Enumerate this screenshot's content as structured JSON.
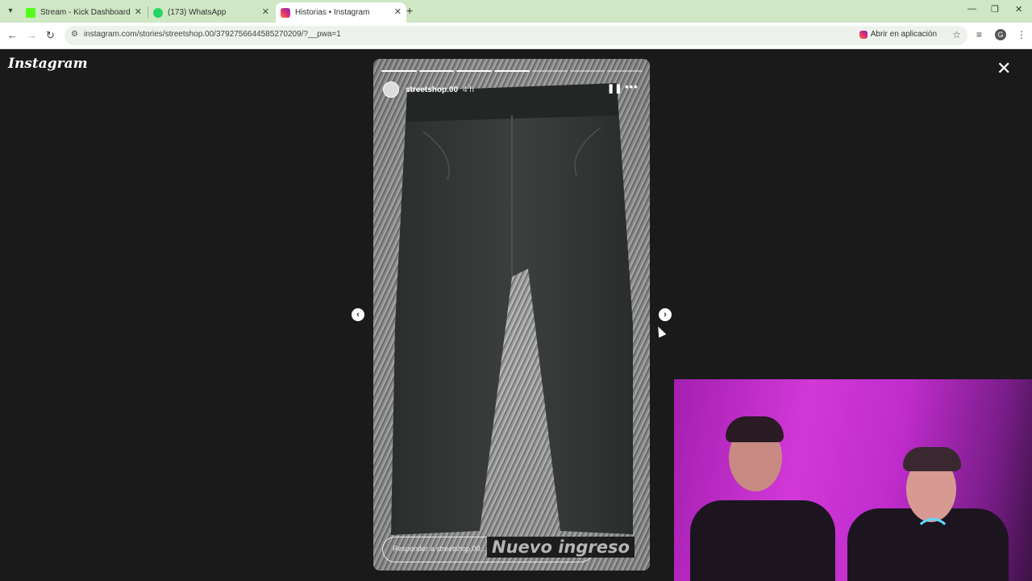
{
  "browser": {
    "tabs": [
      {
        "title": "Stream - Kick Dashboard",
        "icon": "kick-icon",
        "color": "#53fc18",
        "active": false
      },
      {
        "title": "(173) WhatsApp",
        "icon": "whatsapp-icon",
        "color": "#25d366",
        "active": false
      },
      {
        "title": "Historias • Instagram",
        "icon": "instagram-icon",
        "color": "#dd2a7b",
        "active": true
      }
    ],
    "url": "instagram.com/stories/streetshop.00/3792756644585270209/?__pwa=1",
    "open_app_label": "Abrir en aplicación",
    "profile_initial": "G"
  },
  "instagram": {
    "logo": "Instagram",
    "story": {
      "username": "streetshop.00",
      "time": "4 h",
      "segments_total": 7,
      "segments_done": 4,
      "reply_placeholder": "Responder a streetshop.00..."
    }
  },
  "overlay": {
    "text": "Nuevo ingreso"
  },
  "colors": {
    "tabstrip": "#cfe7c4",
    "page_bg": "#1a1a1a",
    "webcam_light": "#d238d8"
  }
}
